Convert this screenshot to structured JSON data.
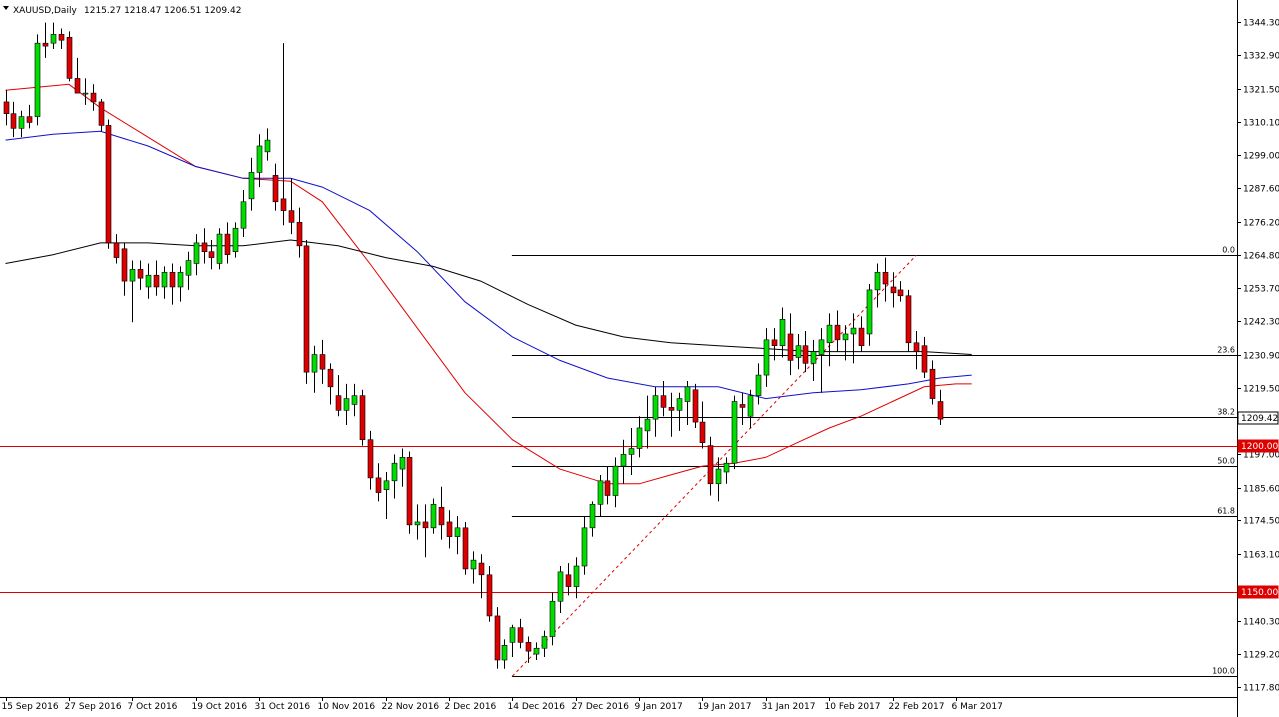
{
  "header": {
    "symbol_label": "XAUUSD,Daily",
    "ohlc_text": "1215.27 1218.47 1206.51 1209.42"
  },
  "colors": {
    "bull": "#00dd00",
    "bear": "#dd0000",
    "ma_red": "#e00000",
    "ma_blue": "#1010cc",
    "ma_black": "#000000",
    "level_red": "#dd0000",
    "fib": "#000000"
  },
  "price_tags": {
    "current": "1209.42",
    "level_1200": "1200.00",
    "level_1150": "1150.00"
  },
  "chart_data": {
    "type": "candlestick",
    "title": "XAUUSD,Daily",
    "ylim": [
      1114.4,
      1351.7
    ],
    "y_ticks": [
      "1344.30",
      "1332.90",
      "1321.50",
      "1310.10",
      "1299.00",
      "1287.60",
      "1276.20",
      "1264.80",
      "1253.70",
      "1242.30",
      "1230.90",
      "1219.50",
      "1197.00",
      "1185.60",
      "1174.50",
      "1163.10",
      "1140.30",
      "1129.20",
      "1117.80"
    ],
    "x_ticks": [
      {
        "label": "15 Sep 2016",
        "bar": 0
      },
      {
        "label": "27 Sep 2016",
        "bar": 8
      },
      {
        "label": "7 Oct 2016",
        "bar": 16
      },
      {
        "label": "19 Oct 2016",
        "bar": 24
      },
      {
        "label": "31 Oct 2016",
        "bar": 32
      },
      {
        "label": "10 Nov 2016",
        "bar": 40
      },
      {
        "label": "22 Nov 2016",
        "bar": 48
      },
      {
        "label": "2 Dec 2016",
        "bar": 56
      },
      {
        "label": "14 Dec 2016",
        "bar": 64
      },
      {
        "label": "27 Dec 2016",
        "bar": 72
      },
      {
        "label": "9 Jan 2017",
        "bar": 80
      },
      {
        "label": "19 Jan 2017",
        "bar": 88
      },
      {
        "label": "31 Jan 2017",
        "bar": 96
      },
      {
        "label": "10 Feb 2017",
        "bar": 104
      },
      {
        "label": "22 Feb 2017",
        "bar": 112
      },
      {
        "label": "6 Mar 2017",
        "bar": 120
      }
    ],
    "candles": [
      [
        1317,
        1321,
        1309,
        1313
      ],
      [
        1313,
        1317,
        1305,
        1308
      ],
      [
        1308,
        1314,
        1305,
        1312
      ],
      [
        1312,
        1316,
        1308,
        1310
      ],
      [
        1312,
        1340,
        1309,
        1337
      ],
      [
        1337,
        1344,
        1332,
        1336
      ],
      [
        1337,
        1344,
        1335,
        1340
      ],
      [
        1340,
        1342,
        1335,
        1338
      ],
      [
        1339,
        1341,
        1324,
        1325
      ],
      [
        1325,
        1332,
        1320,
        1320
      ],
      [
        1320,
        1325,
        1316,
        1320
      ],
      [
        1320,
        1323,
        1314,
        1317
      ],
      [
        1317,
        1318,
        1307,
        1309
      ],
      [
        1309,
        1311,
        1267,
        1269
      ],
      [
        1269,
        1272,
        1262,
        1264
      ],
      [
        1267,
        1269,
        1251,
        1256
      ],
      [
        1256,
        1263,
        1242,
        1260
      ],
      [
        1260,
        1263,
        1253,
        1257
      ],
      [
        1254,
        1262,
        1250,
        1258
      ],
      [
        1258,
        1263,
        1251,
        1254
      ],
      [
        1254,
        1261,
        1250,
        1259
      ],
      [
        1259,
        1262,
        1248,
        1254
      ],
      [
        1254,
        1261,
        1249,
        1259
      ],
      [
        1258,
        1266,
        1253,
        1263
      ],
      [
        1262,
        1272,
        1258,
        1269
      ],
      [
        1269,
        1274,
        1262,
        1266
      ],
      [
        1266,
        1270,
        1260,
        1264
      ],
      [
        1262,
        1274,
        1260,
        1272
      ],
      [
        1272,
        1276,
        1262,
        1265
      ],
      [
        1266,
        1276,
        1264,
        1274
      ],
      [
        1274,
        1287,
        1271,
        1283
      ],
      [
        1284,
        1298,
        1280,
        1293
      ],
      [
        1293,
        1306,
        1288,
        1302
      ],
      [
        1300,
        1308,
        1297,
        1304
      ],
      [
        1292,
        1296,
        1280,
        1283
      ],
      [
        1284,
        1337,
        1275,
        1280
      ],
      [
        1280,
        1291,
        1272,
        1276
      ],
      [
        1276,
        1281,
        1264,
        1268
      ],
      [
        1268,
        1270,
        1221,
        1225
      ],
      [
        1225,
        1234,
        1218,
        1231
      ],
      [
        1231,
        1236,
        1221,
        1226
      ],
      [
        1226,
        1228,
        1214,
        1220
      ],
      [
        1217,
        1224,
        1210,
        1212
      ],
      [
        1212,
        1221,
        1207,
        1216
      ],
      [
        1214,
        1221,
        1210,
        1217
      ],
      [
        1217,
        1219,
        1200,
        1202
      ],
      [
        1202,
        1205,
        1185,
        1189
      ],
      [
        1189,
        1194,
        1181,
        1184
      ],
      [
        1185,
        1191,
        1175,
        1188
      ],
      [
        1188,
        1197,
        1182,
        1194
      ],
      [
        1192,
        1199,
        1186,
        1196
      ],
      [
        1196,
        1198,
        1170,
        1173
      ],
      [
        1173,
        1180,
        1168,
        1174
      ],
      [
        1174,
        1180,
        1162,
        1172
      ],
      [
        1172,
        1182,
        1170,
        1180
      ],
      [
        1179,
        1186,
        1168,
        1173
      ],
      [
        1174,
        1178,
        1165,
        1169
      ],
      [
        1169,
        1176,
        1163,
        1172
      ],
      [
        1172,
        1174,
        1156,
        1158
      ],
      [
        1158,
        1164,
        1153,
        1161
      ],
      [
        1160,
        1163,
        1148,
        1156
      ],
      [
        1156,
        1159,
        1140,
        1142
      ],
      [
        1142,
        1145,
        1124,
        1127
      ],
      [
        1127,
        1134,
        1124,
        1132
      ],
      [
        1133,
        1139,
        1128,
        1138
      ],
      [
        1138,
        1141,
        1131,
        1133
      ],
      [
        1133,
        1135,
        1126,
        1130
      ],
      [
        1129,
        1133,
        1127,
        1131
      ],
      [
        1131,
        1137,
        1128,
        1135
      ],
      [
        1135,
        1150,
        1132,
        1147
      ],
      [
        1147,
        1159,
        1143,
        1157
      ],
      [
        1156,
        1160,
        1149,
        1152
      ],
      [
        1152,
        1162,
        1148,
        1159
      ],
      [
        1159,
        1176,
        1156,
        1172
      ],
      [
        1172,
        1181,
        1169,
        1180
      ],
      [
        1180,
        1190,
        1176,
        1188
      ],
      [
        1188,
        1193,
        1180,
        1183
      ],
      [
        1183,
        1196,
        1179,
        1193
      ],
      [
        1193,
        1202,
        1187,
        1197
      ],
      [
        1197,
        1206,
        1190,
        1199
      ],
      [
        1199,
        1210,
        1196,
        1206
      ],
      [
        1205,
        1217,
        1199,
        1209
      ],
      [
        1209,
        1220,
        1203,
        1217
      ],
      [
        1217,
        1222,
        1210,
        1213
      ],
      [
        1213,
        1218,
        1203,
        1212
      ],
      [
        1212,
        1218,
        1205,
        1216
      ],
      [
        1215,
        1222,
        1207,
        1220
      ],
      [
        1219,
        1221,
        1206,
        1208
      ],
      [
        1208,
        1215,
        1199,
        1201
      ],
      [
        1200,
        1203,
        1183,
        1187
      ],
      [
        1187,
        1196,
        1181,
        1192
      ],
      [
        1191,
        1196,
        1187,
        1194
      ],
      [
        1194,
        1217,
        1192,
        1215
      ],
      [
        1214,
        1218,
        1207,
        1213
      ],
      [
        1210,
        1219,
        1206,
        1217
      ],
      [
        1217,
        1228,
        1214,
        1224
      ],
      [
        1224,
        1240,
        1220,
        1236
      ],
      [
        1236,
        1240,
        1229,
        1234
      ],
      [
        1234,
        1247,
        1230,
        1243
      ],
      [
        1238,
        1245,
        1224,
        1229
      ],
      [
        1230,
        1238,
        1226,
        1234
      ],
      [
        1234,
        1239,
        1225,
        1228
      ],
      [
        1228,
        1236,
        1222,
        1232
      ],
      [
        1231,
        1240,
        1218,
        1236
      ],
      [
        1235,
        1245,
        1227,
        1241
      ],
      [
        1241,
        1246,
        1232,
        1236
      ],
      [
        1236,
        1241,
        1229,
        1238
      ],
      [
        1238,
        1245,
        1228,
        1240
      ],
      [
        1240,
        1244,
        1232,
        1234
      ],
      [
        1238,
        1255,
        1234,
        1253
      ],
      [
        1253,
        1262,
        1247,
        1259
      ],
      [
        1259,
        1264,
        1249,
        1255
      ],
      [
        1254,
        1259,
        1247,
        1252
      ],
      [
        1253,
        1256,
        1249,
        1251
      ],
      [
        1251,
        1253,
        1232,
        1235
      ],
      [
        1235,
        1239,
        1226,
        1232
      ],
      [
        1234,
        1237,
        1223,
        1225
      ],
      [
        1226,
        1229,
        1214,
        1216
      ],
      [
        1215,
        1219,
        1207,
        1209
      ]
    ],
    "series": [
      {
        "color": "ma_red",
        "points": [
          [
            0,
            1321
          ],
          [
            8,
            1323
          ],
          [
            12,
            1315
          ],
          [
            18,
            1305
          ],
          [
            24,
            1295
          ],
          [
            30,
            1291
          ],
          [
            36,
            1290
          ],
          [
            40,
            1283
          ],
          [
            46,
            1262
          ],
          [
            52,
            1240
          ],
          [
            58,
            1218
          ],
          [
            64,
            1202
          ],
          [
            70,
            1192
          ],
          [
            76,
            1187
          ],
          [
            80,
            1187
          ],
          [
            84,
            1190
          ],
          [
            88,
            1193
          ],
          [
            92,
            1194
          ],
          [
            96,
            1196
          ],
          [
            100,
            1201
          ],
          [
            104,
            1206
          ],
          [
            108,
            1210
          ],
          [
            112,
            1215
          ],
          [
            116,
            1220
          ],
          [
            120,
            1221
          ],
          [
            122,
            1221
          ]
        ]
      },
      {
        "color": "ma_blue",
        "points": [
          [
            0,
            1304
          ],
          [
            6,
            1306
          ],
          [
            12,
            1307
          ],
          [
            18,
            1302
          ],
          [
            24,
            1295
          ],
          [
            30,
            1291
          ],
          [
            36,
            1291
          ],
          [
            40,
            1288
          ],
          [
            46,
            1280
          ],
          [
            52,
            1266
          ],
          [
            58,
            1249
          ],
          [
            64,
            1237
          ],
          [
            70,
            1229
          ],
          [
            76,
            1223
          ],
          [
            82,
            1220
          ],
          [
            90,
            1220
          ],
          [
            96,
            1216
          ],
          [
            102,
            1218
          ],
          [
            108,
            1219
          ],
          [
            114,
            1221
          ],
          [
            118,
            1223
          ],
          [
            122,
            1224
          ]
        ]
      },
      {
        "color": "ma_black",
        "points": [
          [
            0,
            1262
          ],
          [
            6,
            1265
          ],
          [
            12,
            1269
          ],
          [
            18,
            1269
          ],
          [
            24,
            1268
          ],
          [
            30,
            1268
          ],
          [
            36,
            1270
          ],
          [
            42,
            1268
          ],
          [
            48,
            1264
          ],
          [
            54,
            1261
          ],
          [
            60,
            1256
          ],
          [
            66,
            1248
          ],
          [
            72,
            1241
          ],
          [
            78,
            1237
          ],
          [
            84,
            1235
          ],
          [
            90,
            1234
          ],
          [
            96,
            1233
          ],
          [
            102,
            1232
          ],
          [
            110,
            1232
          ],
          [
            116,
            1232
          ],
          [
            122,
            1231
          ]
        ]
      }
    ],
    "fib_levels": [
      {
        "label": "0.0",
        "price": 1264.8
      },
      {
        "label": "23.6",
        "price": 1231.0
      },
      {
        "label": "38.2",
        "price": 1209.8
      },
      {
        "label": "50.0",
        "price": 1192.9
      },
      {
        "label": "61.8",
        "price": 1176.0
      },
      {
        "label": "100.0",
        "price": 1121.5
      }
    ],
    "fib_start_bar": 64,
    "fib_trend_from": [
      64,
      1121.5
    ],
    "fib_trend_to": [
      115,
      1264.8
    ],
    "horizontal_levels": [
      1200.0,
      1150.0
    ],
    "current_price": 1209.42
  }
}
